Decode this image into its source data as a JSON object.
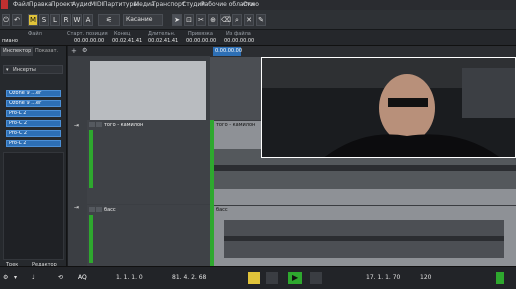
{
  "menu": [
    "Файл",
    "Правка",
    "Проект",
    "Аудио",
    "MIDI",
    "Партитуры",
    "Медиа",
    "Транспорт",
    "Студия",
    "Рабочие области",
    "Окно"
  ],
  "toolbar": {
    "m_label": "M",
    "s_label": "S",
    "l_label": "L",
    "r_label": "R",
    "w_label": "W",
    "a_label": "A",
    "mode_select": "Касание"
  },
  "infobar": {
    "file_label": "Файл",
    "file_value": "пиано",
    "start_label": "Старт. позиция",
    "start_value": "00.00.00.00",
    "end_label": "Конец",
    "end_value": "00.02.41.41",
    "length_label": "Длительн.",
    "length_value": "00.02.41.41",
    "snap_label": "Привязка",
    "snap_value": "00.00.00.00",
    "infile_label": "Из файла",
    "infile_value": "00.00.00.00"
  },
  "inspector": {
    "tab_inspector": "Инспектор",
    "tab_show": "Показат.",
    "section_inserts": "Инсерты",
    "inserts": [
      "Ozone 9 ...er",
      "Ozone 9 ...er",
      "Pro-L 2",
      "Pro-C 2",
      "Pro-C 2",
      "Pro-L 2"
    ],
    "bottom_tab_track": "Трек",
    "bottom_tab_editor": "Редактор"
  },
  "tracks": [
    {
      "name": "того - камилон",
      "clip": "того - камилон"
    },
    {
      "name": "басс",
      "clip": "басс"
    }
  ],
  "ruler": {
    "marker": "0.00.00.00"
  },
  "transport": {
    "aq_label": "AQ",
    "position_left": "1. 1. 1. 0",
    "position_right": "81. 4. 2. 68",
    "tempo_left": "17. 1. 1. 70",
    "tempo_right": "120"
  },
  "colors": {
    "accent_blue": "#2d6fb5",
    "waveform_bg": "#8e9196",
    "play_green": "#2ea82e",
    "yellow": "#e0c33a"
  }
}
